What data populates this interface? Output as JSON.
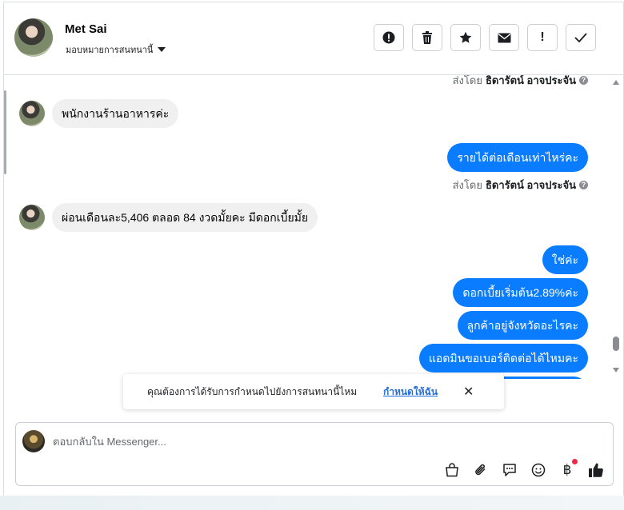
{
  "header": {
    "contact_name": "Met Sai",
    "assign_label": "มอบหมายการสนทนานี้",
    "toolbar": [
      {
        "icon": "alert-circle-icon",
        "glyph": "!"
      },
      {
        "icon": "trash-icon",
        "glyph": "🗑"
      },
      {
        "icon": "star-icon",
        "glyph": "★"
      },
      {
        "icon": "envelope-icon",
        "glyph": "✉"
      },
      {
        "icon": "exclamation-icon",
        "glyph": "!"
      },
      {
        "icon": "check-icon",
        "glyph": "✓"
      }
    ]
  },
  "messages": {
    "sent_by_1": {
      "prefix": "ส่งโดย",
      "name": "ธิดารัตน์ อาจประจัน"
    },
    "incoming_1": "พนักงานร้านอาหารค่ะ",
    "outgoing_1": "รายได้ต่อเดือนเท่าไหร่คะ",
    "sent_by_2": {
      "prefix": "ส่งโดย",
      "name": "ธิดารัตน์ อาจประจัน"
    },
    "incoming_2": "ผ่อนเดือนละ5,406 ตลอด 84 งวดมั้ยคะ มีดอกเบี้ยมั้ย",
    "outgoing_2": "ใช่ค่ะ",
    "outgoing_3": "ดอกเบี้ยเริ่มต้น2.89%ค่ะ",
    "outgoing_4": "ลูกค้าอยู่จังหวัดอะไรคะ",
    "outgoing_5": "แอดมินขอเบอร์ติดต่อได้ไหมคะ"
  },
  "toast": {
    "text": "คุณต้องการได้รับการกำหนดไปยังการสนทนานี้ไหม",
    "link": "กำหนดให้ฉัน"
  },
  "composer": {
    "placeholder": "ตอบกลับใน Messenger...",
    "icons": [
      "shopping-bag-icon",
      "paperclip-icon",
      "saved-reply-icon",
      "emoji-icon",
      "baht-payment-icon",
      "thumbs-up-icon"
    ]
  },
  "colors": {
    "accent": "#0a7cff",
    "incoming_bubble": "#f0f0f0",
    "link": "#216fdb",
    "notification": "#f02849"
  }
}
